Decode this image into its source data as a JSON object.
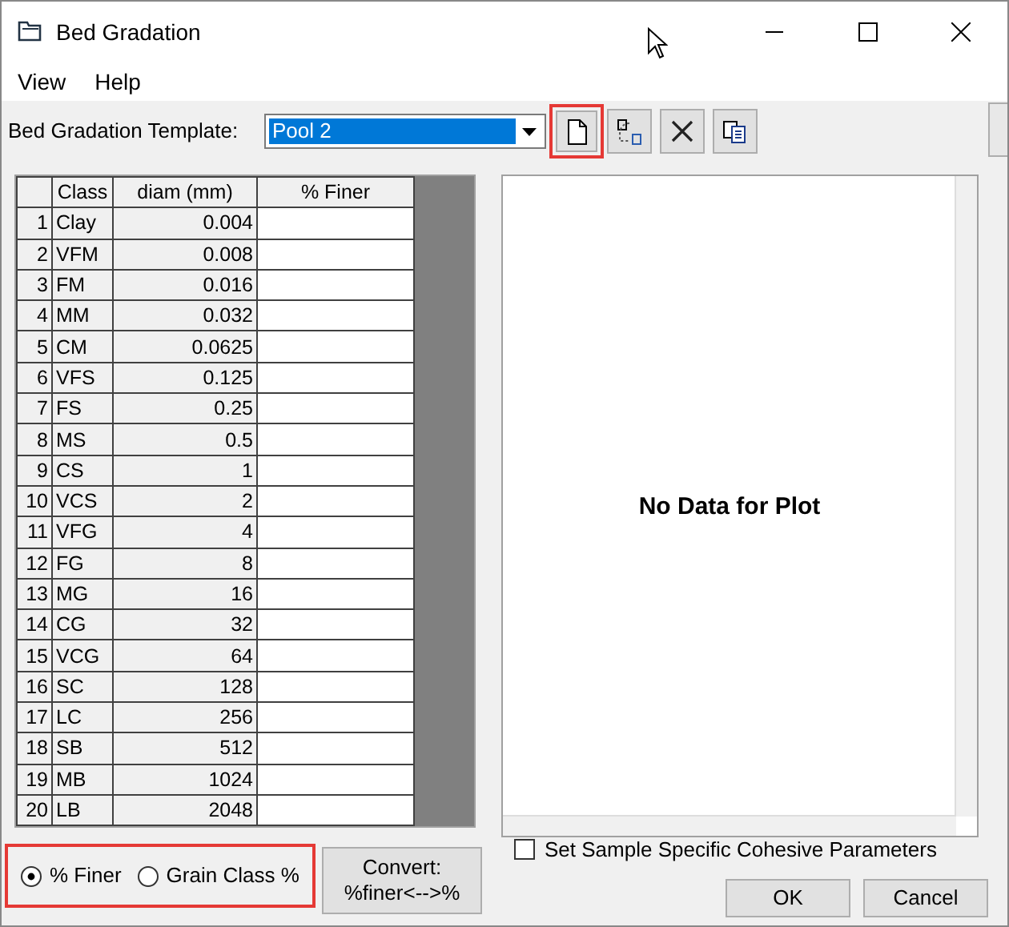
{
  "window": {
    "title": "Bed Gradation"
  },
  "menu": [
    "View",
    "Help"
  ],
  "template": {
    "label": "Bed Gradation Template:",
    "value": "Pool 2"
  },
  "toolbar": [
    {
      "kind": "new",
      "highlighted": true
    },
    {
      "kind": "rename",
      "highlighted": false
    },
    {
      "kind": "delete",
      "highlighted": false
    },
    {
      "kind": "copy",
      "highlighted": false
    }
  ],
  "table": {
    "columns": [
      "Class",
      "diam (mm)",
      "% Finer"
    ],
    "rows": [
      {
        "index": "1",
        "class": "Clay",
        "diam": "0.004"
      },
      {
        "index": "2",
        "class": "VFM",
        "diam": "0.008"
      },
      {
        "index": "3",
        "class": "FM",
        "diam": "0.016"
      },
      {
        "index": "4",
        "class": "MM",
        "diam": "0.032"
      },
      {
        "index": "5",
        "class": "CM",
        "diam": "0.0625"
      },
      {
        "index": "6",
        "class": "VFS",
        "diam": "0.125"
      },
      {
        "index": "7",
        "class": "FS",
        "diam": "0.25"
      },
      {
        "index": "8",
        "class": "MS",
        "diam": "0.5"
      },
      {
        "index": "9",
        "class": "CS",
        "diam": "1"
      },
      {
        "index": "10",
        "class": "VCS",
        "diam": "2"
      },
      {
        "index": "11",
        "class": "VFG",
        "diam": "4"
      },
      {
        "index": "12",
        "class": "FG",
        "diam": "8"
      },
      {
        "index": "13",
        "class": "MG",
        "diam": "16"
      },
      {
        "index": "14",
        "class": "CG",
        "diam": "32"
      },
      {
        "index": "15",
        "class": "VCG",
        "diam": "64"
      },
      {
        "index": "16",
        "class": "SC",
        "diam": "128"
      },
      {
        "index": "17",
        "class": "LC",
        "diam": "256"
      },
      {
        "index": "18",
        "class": "SB",
        "diam": "512"
      },
      {
        "index": "19",
        "class": "MB",
        "diam": "1024"
      },
      {
        "index": "20",
        "class": "LB",
        "diam": "2048"
      }
    ]
  },
  "plot": {
    "message": "No Data for Plot"
  },
  "mode": {
    "highlighted": true,
    "options": [
      {
        "label": "% Finer",
        "selected": true
      },
      {
        "label": "Grain Class %",
        "selected": false
      }
    ]
  },
  "convert_button": {
    "lines": [
      "Convert:",
      "%finer<-->%"
    ]
  },
  "cohesive": {
    "label": "Set Sample Specific Cohesive Parameters",
    "checked": false
  },
  "buttons": [
    "OK",
    "Cancel"
  ]
}
